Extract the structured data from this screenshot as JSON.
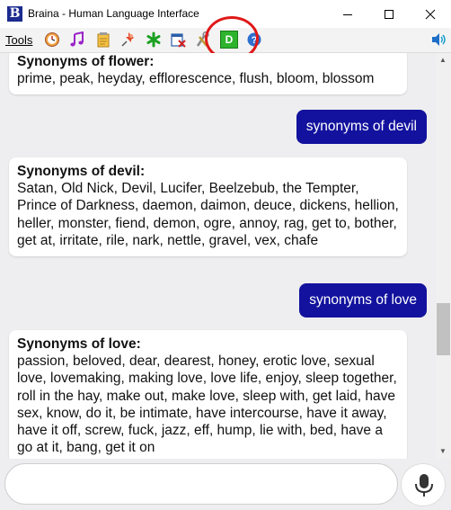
{
  "window": {
    "app_icon_letter": "B",
    "title": "Braina - Human Language Interface"
  },
  "toolbar": {
    "tools_menu": "Tools",
    "highlighted_button_letter": "D",
    "icons": [
      "clock-icon",
      "music-note-icon",
      "notepad-icon",
      "pushpin-icon",
      "asterisk-icon",
      "calendar-icon",
      "tools-icon",
      "d-button-icon",
      "help-icon",
      "speaker-icon"
    ],
    "colors": {
      "highlight_button": "#2db32d",
      "annotation_ring": "#e01818"
    }
  },
  "chat": {
    "messages": [
      {
        "from": "braina",
        "heading": "Synonyms of flower:",
        "body": "prime, peak, heyday, efflorescence, flush, bloom, blossom"
      },
      {
        "from": "user",
        "text": "synonyms of devil"
      },
      {
        "from": "braina",
        "heading": "Synonyms of devil:",
        "body": "Satan, Old Nick, Devil, Lucifer, Beelzebub, the Tempter, Prince of Darkness, daemon, daimon, deuce, dickens, hellion, heller, monster, fiend, demon, ogre, annoy, rag, get to, bother, get at, irritate, rile, nark, nettle, gravel, vex, chafe"
      },
      {
        "from": "user",
        "text": "synonyms of love"
      },
      {
        "from": "braina",
        "heading": "Synonyms of love:",
        "body": "passion, beloved, dear, dearest, honey, erotic love, sexual love, lovemaking, making love, love life, enjoy, sleep together, roll in the hay, make out, make love, sleep with, get laid, have sex, know, do it, be intimate, have intercourse, have it away, have it off, screw, fuck, jazz, eff, hump, lie with, bed, have a go at it, bang, get it on"
      }
    ],
    "colors": {
      "user_bubble": "#12129e",
      "reply_bubble": "#ffffff",
      "background": "#eeeef0"
    }
  },
  "input": {
    "value": "",
    "placeholder": ""
  }
}
